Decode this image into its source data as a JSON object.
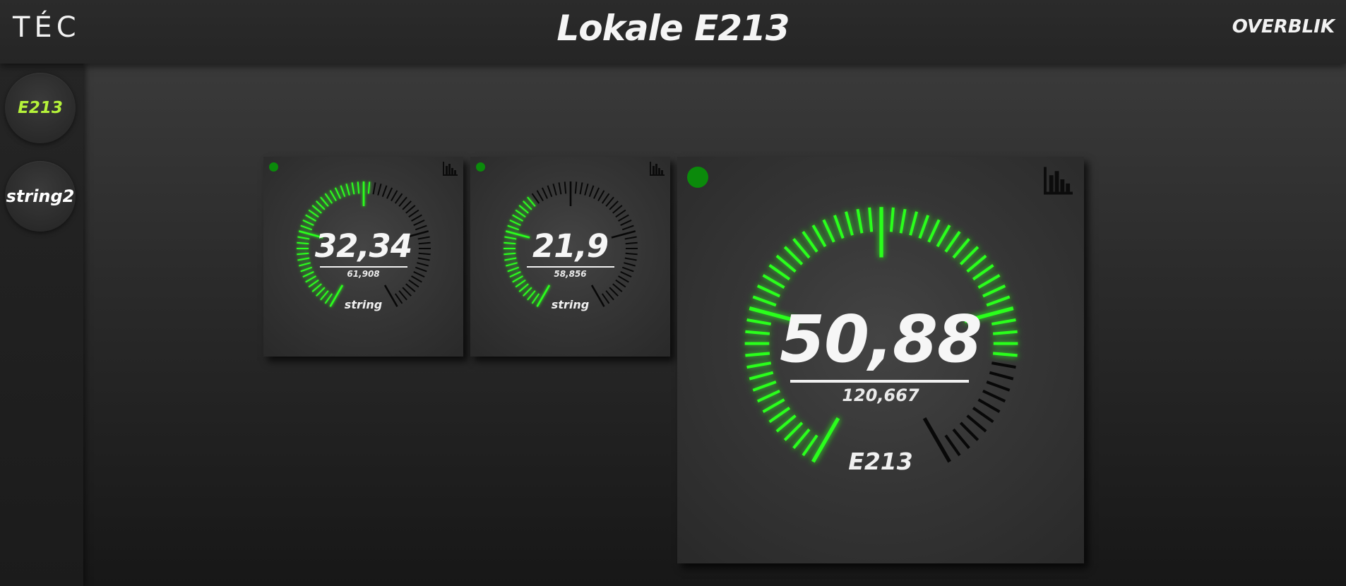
{
  "header": {
    "logo": "TÉC",
    "title": "Lokale E213",
    "overview_link": "OVERBLIK"
  },
  "sidebar": {
    "items": [
      {
        "label": "E213",
        "active": true,
        "color": "#b5f23a"
      },
      {
        "label": "string2",
        "active": false,
        "color": "#ffffff"
      }
    ]
  },
  "colors": {
    "accent_green": "#2cff1e",
    "inactive_tick": "#080808",
    "status_dot": "#0b8a0b"
  },
  "gauges": [
    {
      "value": "32,34",
      "sub_value": "61,908",
      "label": "string",
      "fill_fraction": 0.52,
      "status_icon": "status-dot",
      "chart_icon": "bar-chart-icon"
    },
    {
      "value": "21,9",
      "sub_value": "58,856",
      "label": "string",
      "fill_fraction": 0.37,
      "status_icon": "status-dot",
      "chart_icon": "bar-chart-icon"
    },
    {
      "value": "50,88",
      "sub_value": "120,667",
      "label": "E213",
      "fill_fraction": 0.82,
      "status_icon": "status-dot",
      "chart_icon": "bar-chart-icon"
    }
  ]
}
